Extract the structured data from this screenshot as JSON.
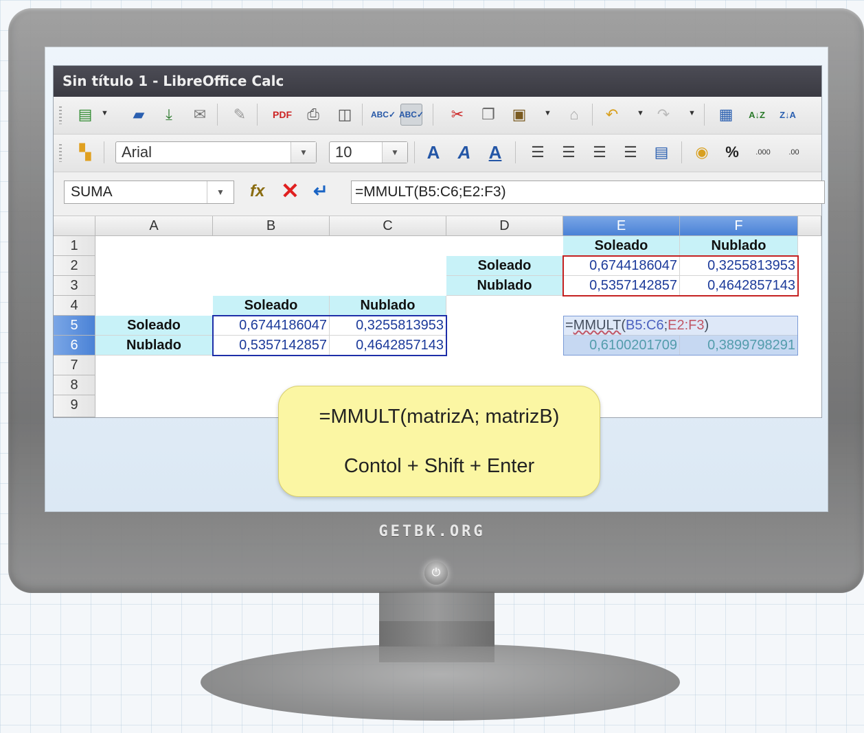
{
  "window": {
    "title": "Sin título 1 - LibreOffice Calc"
  },
  "toolbar_standard": {
    "icons": [
      "new-icon",
      "open-icon",
      "save-icon",
      "email-icon",
      "edit-file-icon",
      "export-pdf-icon",
      "print-icon",
      "print-preview-icon",
      "spellcheck-icon",
      "autospellcheck-icon",
      "cut-icon",
      "copy-icon",
      "paste-icon",
      "clone-format-icon",
      "undo-icon",
      "redo-icon",
      "chart-icon",
      "sort-ascending-icon",
      "sort-descending-icon"
    ],
    "autospellcheck_active": true
  },
  "toolbar_formatting": {
    "font_name": "Arial",
    "font_size": "10"
  },
  "formula_bar": {
    "name_box": "SUMA",
    "formula": "=MMULT(B5:C6;E2:F3)"
  },
  "columns": [
    "A",
    "B",
    "C",
    "D",
    "E",
    "F"
  ],
  "rows": [
    "1",
    "2",
    "3",
    "4",
    "5",
    "6",
    "7",
    "8",
    "9"
  ],
  "selected_columns": [
    "E",
    "F"
  ],
  "selected_rows": [
    "5",
    "6"
  ],
  "cells": {
    "E1": "Soleado",
    "F1": "Nublado",
    "D2": "Soleado",
    "E2": "0,6744186047",
    "F2": "0,3255813953",
    "D3": "Nublado",
    "E3": "0,5357142857",
    "F3": "0,4642857143",
    "B4": "Soleado",
    "C4": "Nublado",
    "A5": "Soleado",
    "B5": "0,6744186047",
    "C5": "0,3255813953",
    "A6": "Nublado",
    "B6": "0,5357142857",
    "C6": "0,4642857143",
    "E5_parts": {
      "prefix": "=",
      "fn": "MMULT",
      "open": "(",
      "range1": "B5:C6",
      "semi": ";",
      "range2": "E2:F3",
      "close": ")"
    },
    "E6": "0,6100201709",
    "F6": "0,3899798291"
  },
  "tooltip": {
    "line1": "=MMULT(matrizA; matrizB)",
    "line2": "Contol + Shift + Enter"
  },
  "brand": "GETBK.ORG",
  "colors": {
    "titlebar": "#3f3f47",
    "header_fill": "#c8f2f8",
    "range_blue": "#1d2ea8",
    "range_red": "#d21f1f",
    "selection": "#4a82d6",
    "tooltip": "#fbf6a3"
  }
}
